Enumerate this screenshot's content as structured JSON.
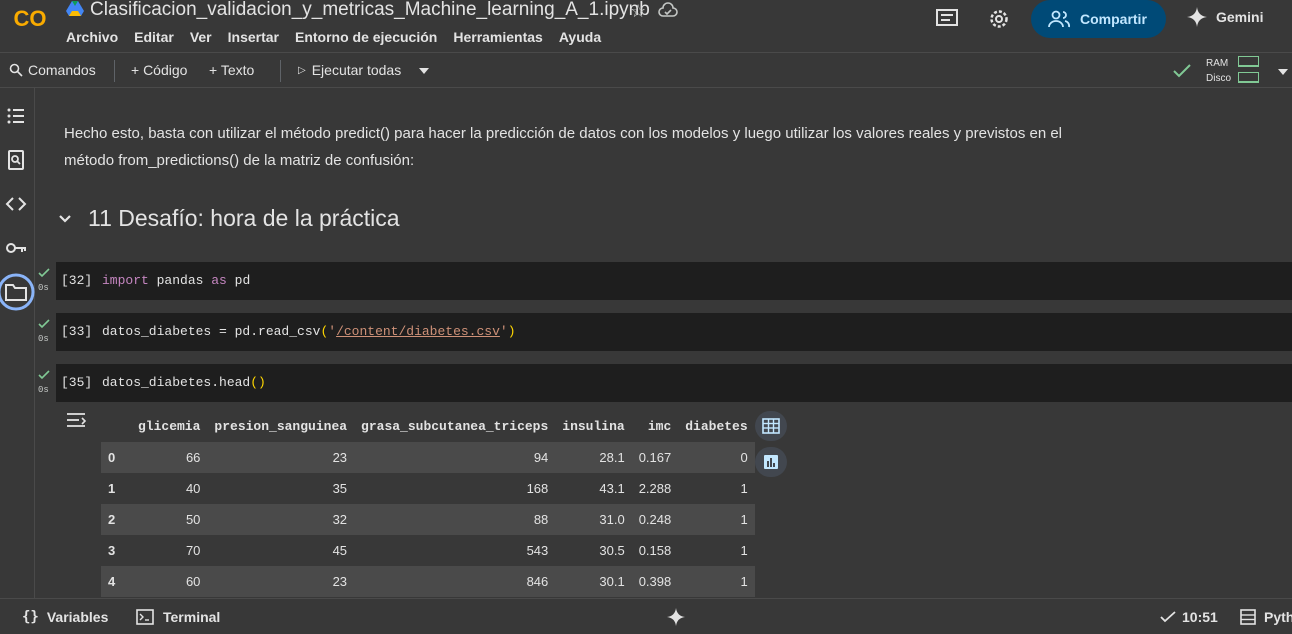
{
  "header": {
    "title": "Clasificacion_validacion_y_metricas_Machine_learning_A_1.ipynb",
    "menu": [
      "Archivo",
      "Editar",
      "Ver",
      "Insertar",
      "Entorno de ejecución",
      "Herramientas",
      "Ayuda"
    ],
    "share_label": "Compartir",
    "gemini_label": "Gemini",
    "logo_text": "CO"
  },
  "toolbar": {
    "commands_label": "Comandos",
    "add_code_label": "+ Código",
    "add_text_label": "+ Texto",
    "run_all_label": "Ejecutar todas",
    "ram_label": "RAM",
    "disk_label": "Disco",
    "ram_usage": 0.15,
    "disk_usage": 0.15
  },
  "notebook": {
    "markdown": "Hecho esto, basta con utilizar el método predict() para hacer la predicción de datos con los modelos y luego utilizar los valores reales y previstos en el método from_predictions() de la matriz de confusión:",
    "section_title": "11 Desafío: hora de la práctica",
    "cells": [
      {
        "exec": "[32]",
        "time": "0s",
        "code": "import pandas as pd"
      },
      {
        "exec": "[33]",
        "time": "0s",
        "code": "datos_diabetes = pd.read_csv('/content/diabetes.csv')"
      },
      {
        "exec": "[35]",
        "time": "0s",
        "code": "datos_diabetes.head()"
      }
    ],
    "table": {
      "columns": [
        "",
        "glicemia",
        "presion_sanguinea",
        "grasa_subcutanea_triceps",
        "insulina",
        "imc",
        "diabetes"
      ],
      "rows": [
        [
          "0",
          "66",
          "23",
          "94",
          "28.1",
          "0.167",
          "0"
        ],
        [
          "1",
          "40",
          "35",
          "168",
          "43.1",
          "2.288",
          "1"
        ],
        [
          "2",
          "50",
          "32",
          "88",
          "31.0",
          "0.248",
          "1"
        ],
        [
          "3",
          "70",
          "45",
          "543",
          "30.5",
          "0.158",
          "1"
        ],
        [
          "4",
          "60",
          "23",
          "846",
          "30.1",
          "0.398",
          "1"
        ]
      ]
    }
  },
  "statusbar": {
    "variables_label": "Variables",
    "terminal_label": "Terminal",
    "time_label": "10:51",
    "runtime_label": "Pyth"
  },
  "colors": {
    "accent": "#004a77",
    "check": "#81c995",
    "logo": "#f9ab00"
  }
}
